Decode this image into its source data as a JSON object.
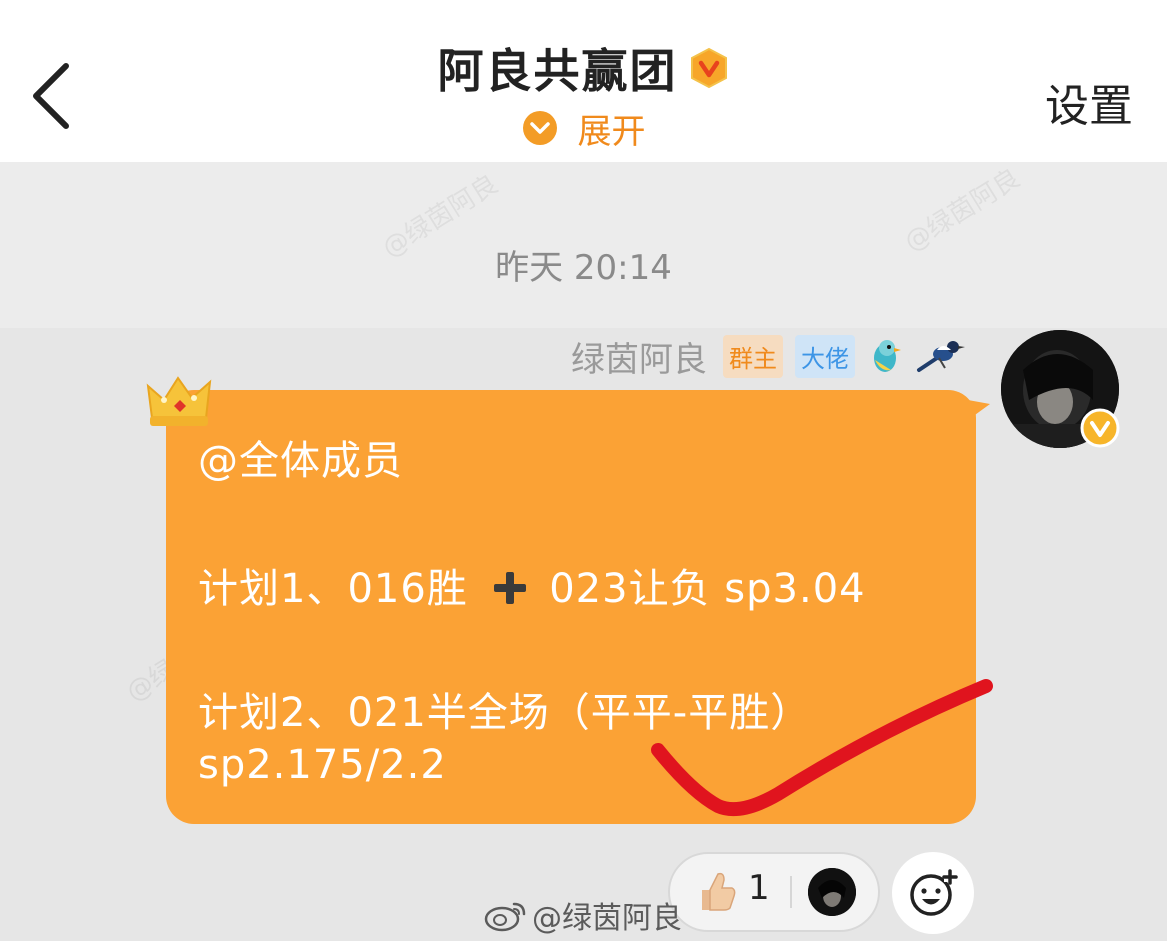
{
  "header": {
    "title": "阿良共赢团",
    "expand_label": "展开",
    "settings_label": "设置"
  },
  "timestamp": "昨天 20:14",
  "watermark": "@绿茵阿良",
  "message": {
    "sender_name": "绿茵阿良",
    "tags": {
      "owner": "群主",
      "boss": "大佬"
    },
    "lines": [
      "@全体成员",
      "计划1、016胜",
      "023让负 sp3.04",
      "计划2、021半全场（平平-平胜）",
      "sp2.175/2.2"
    ]
  },
  "reaction": {
    "count": "1"
  },
  "footer_watermark": "@绿茵阿良",
  "colors": {
    "accent": "#f08a1c",
    "bubble": "#fba235",
    "check_mark": "#e0141e"
  },
  "icons": [
    "back-chevron-icon",
    "verified-v-icon",
    "expand-chevron-icon",
    "crown-icon",
    "bird-icon",
    "plus-icon",
    "thumbs-up-icon",
    "add-emoji-icon",
    "weibo-logo-icon"
  ]
}
